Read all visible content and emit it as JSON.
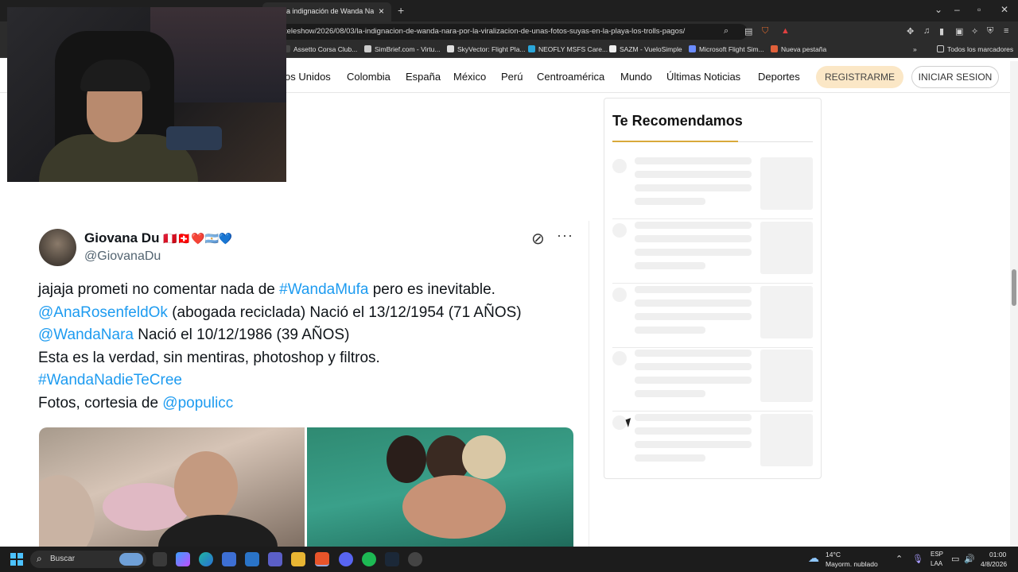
{
  "browser": {
    "tab_title": "a indignación de Wanda Nara p",
    "tab_close": "×",
    "tab_new": "+",
    "url": "teleshow/2026/08/03/la-indignacion-de-wanda-nara-por-la-viralizacion-de-unas-fotos-suyas-en-la-playa-los-trolls-pagos/",
    "bookmarks": [
      {
        "label": "Assetto Corsa Club...",
        "color": "#444444"
      },
      {
        "label": "SimBrief.com - Virtu...",
        "color": "#cccccc"
      },
      {
        "label": "SkyVector: Flight Pla...",
        "color": "#dddddd"
      },
      {
        "label": "NEOFLY MSFS Care...",
        "color": "#2aa6d9"
      },
      {
        "label": "SAZM - VueloSimple",
        "color": "#eeeeee"
      },
      {
        "label": "Microsoft Flight Sim...",
        "color": "#6b8cff"
      },
      {
        "label": "Nueva pestaña",
        "color": "#e0603a"
      }
    ],
    "all_bookmarks": "Todos los marcadores"
  },
  "site_nav": {
    "items": [
      "os Unidos",
      "Colombia",
      "España",
      "México",
      "Perú",
      "Centroamérica",
      "Mundo",
      "Últimas Noticias",
      "Deportes"
    ],
    "register": "REGISTRARME",
    "login": "INICIAR SESION"
  },
  "tweet": {
    "name": "Giovana Du",
    "flags": "🇵🇪🇨🇭❤️🇦🇷💙",
    "handle": "@GiovanaDu",
    "more": "···",
    "line1_a": "jajaja prometi no comentar nada de ",
    "line1_link": "#WandaMufa",
    "line1_b": " pero es inevitable.",
    "line2_link": "@AnaRosenfeldOk",
    "line2_b": " (abogada reciclada) Nació el 13/12/1954 (71 AÑOS)",
    "line3_link": "@WandaNara",
    "line3_b": " Nació el 10/12/1986 (39 AÑOS)",
    "line4": "Esta es la verdad, sin mentiras, photoshop y filtros.",
    "line5_link": "#WandaNadieTeCree",
    "line6_a": "Fotos, cortesia de ",
    "line6_link": "@populicc"
  },
  "recommendations": {
    "title": "Te Recomendamos",
    "accent_color": "#d9a93a",
    "skeleton_rows": 5
  },
  "taskbar": {
    "search_placeholder": "Buscar",
    "weather_temp": "14°C",
    "weather_desc": "Mayorm. nublado",
    "lang_top": "ESP",
    "lang_bottom": "LAA",
    "time": "01:00",
    "date": "4/8/2026"
  }
}
